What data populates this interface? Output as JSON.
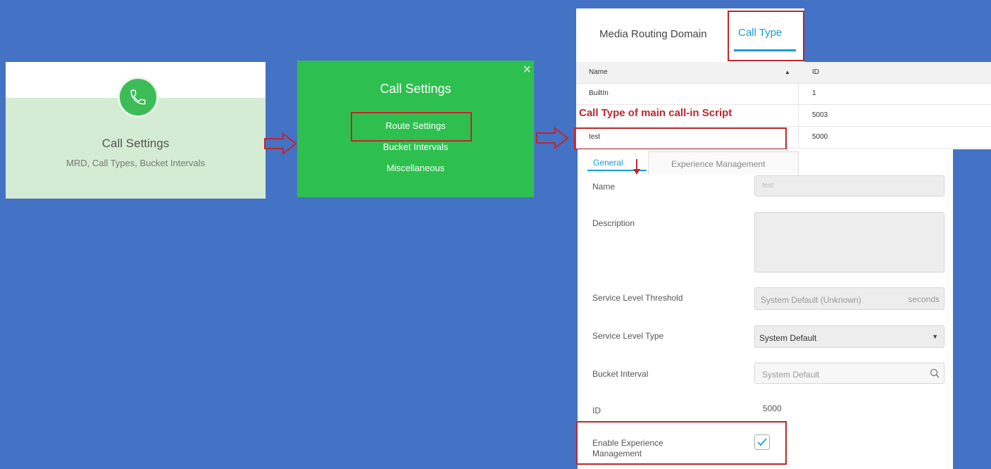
{
  "card_call_settings": {
    "title": "Call Settings",
    "subtitle": "MRD, Call Types, Bucket Intervals",
    "icon": "phone-icon"
  },
  "menu_call_settings": {
    "title": "Call Settings",
    "close_icon": "×",
    "items": [
      "Route Settings",
      "Bucket Intervals",
      "Miscellaneous"
    ]
  },
  "tabs": {
    "media_routing_domain": "Media Routing Domain",
    "call_type": "Call Type"
  },
  "table": {
    "columns": [
      "Name",
      "ID"
    ],
    "sort_indicator": "▲",
    "rows": [
      {
        "name": "BuiltIn",
        "id": "1"
      },
      {
        "name": "",
        "id": "5003"
      },
      {
        "name": "test",
        "id": "5000"
      }
    ]
  },
  "annotation": "Call Type of main call-in Script",
  "detail": {
    "tabs": [
      "General",
      "Experience Management"
    ],
    "name_label": "Name",
    "name_value": "test",
    "description_label": "Description",
    "slt_label": "Service Level Threshold",
    "slt_placeholder": "System Default (Unknown)",
    "slt_unit": "seconds",
    "slt_type_label": "Service Level Type",
    "slt_type_value": "System Default",
    "bucket_label": "Bucket Interval",
    "bucket_placeholder": "System Default",
    "id_label": "ID",
    "id_value": "5000",
    "enable_em_label_1": "Enable Experience",
    "enable_em_label_2": "Management",
    "enable_em_checked": true
  },
  "colors": {
    "background": "#4472c4",
    "green": "#2ec04f",
    "highlight": "#c0262c",
    "accent": "#1a9bd7"
  }
}
